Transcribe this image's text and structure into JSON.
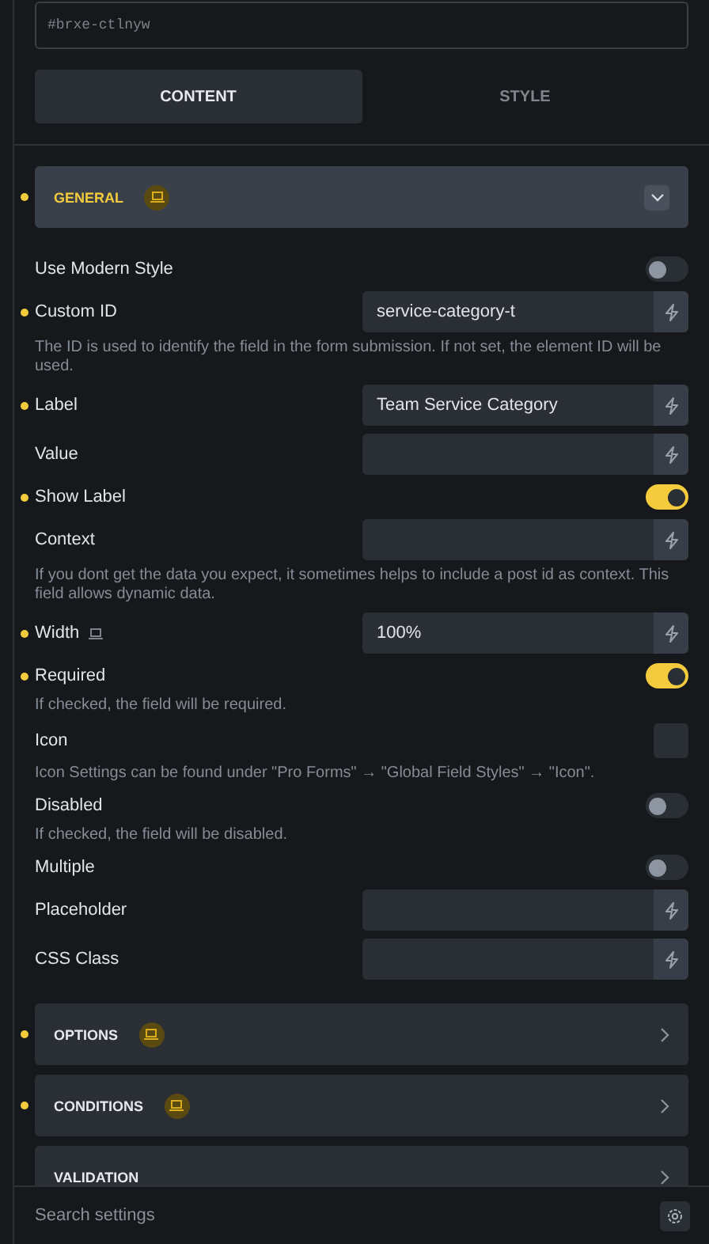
{
  "element_id_field": {
    "placeholder": "#brxe-ctlnyw"
  },
  "tabs": [
    {
      "label": "CONTENT",
      "selected": true
    },
    {
      "label": "STYLE",
      "selected": false
    }
  ],
  "sections": [
    {
      "title": "GENERAL",
      "modified": true,
      "responsive": true,
      "expanded": true,
      "settings": [
        {
          "kind": "toggle",
          "label": "Use Modern Style",
          "modified": false,
          "on": false
        },
        {
          "kind": "text",
          "label": "Custom ID",
          "modified": true,
          "value": "service-category-t",
          "help": "The ID is used to identify the field in the form submission. If not set, the element ID will be used."
        },
        {
          "kind": "text",
          "label": "Label",
          "modified": true,
          "value": "Team Service Category"
        },
        {
          "kind": "text",
          "label": "Value",
          "modified": false
        },
        {
          "kind": "toggle",
          "label": "Show Label",
          "modified": true,
          "on": true
        },
        {
          "kind": "text",
          "label": "Context",
          "modified": false,
          "help": "If you dont get the data you expect, it sometimes helps to include a post id as context. This field allows dynamic data."
        },
        {
          "kind": "text",
          "label": "Width",
          "modified": true,
          "responsive": true,
          "value": "100%"
        },
        {
          "kind": "toggle",
          "label": "Required",
          "modified": true,
          "on": true,
          "help": "If checked, the field will be required."
        },
        {
          "kind": "icon_picker",
          "label": "Icon",
          "modified": false,
          "help": "Icon Settings can be found under \"Pro Forms\" → \"Global Field Styles\" → \"Icon\"."
        },
        {
          "kind": "toggle",
          "label": "Disabled",
          "modified": false,
          "on": false,
          "help": "If checked, the field will be disabled."
        },
        {
          "kind": "toggle",
          "label": "Multiple",
          "modified": false,
          "on": false
        },
        {
          "kind": "text",
          "label": "Placeholder",
          "modified": false
        },
        {
          "kind": "text",
          "label": "CSS Class",
          "modified": false
        }
      ]
    },
    {
      "title": "OPTIONS",
      "modified": true,
      "responsive": true,
      "expanded": false
    },
    {
      "title": "CONDITIONS",
      "modified": true,
      "responsive": true,
      "expanded": false
    },
    {
      "title": "VALIDATION",
      "modified": false,
      "responsive": false,
      "expanded": false
    }
  ],
  "search": {
    "placeholder": "Search settings"
  }
}
